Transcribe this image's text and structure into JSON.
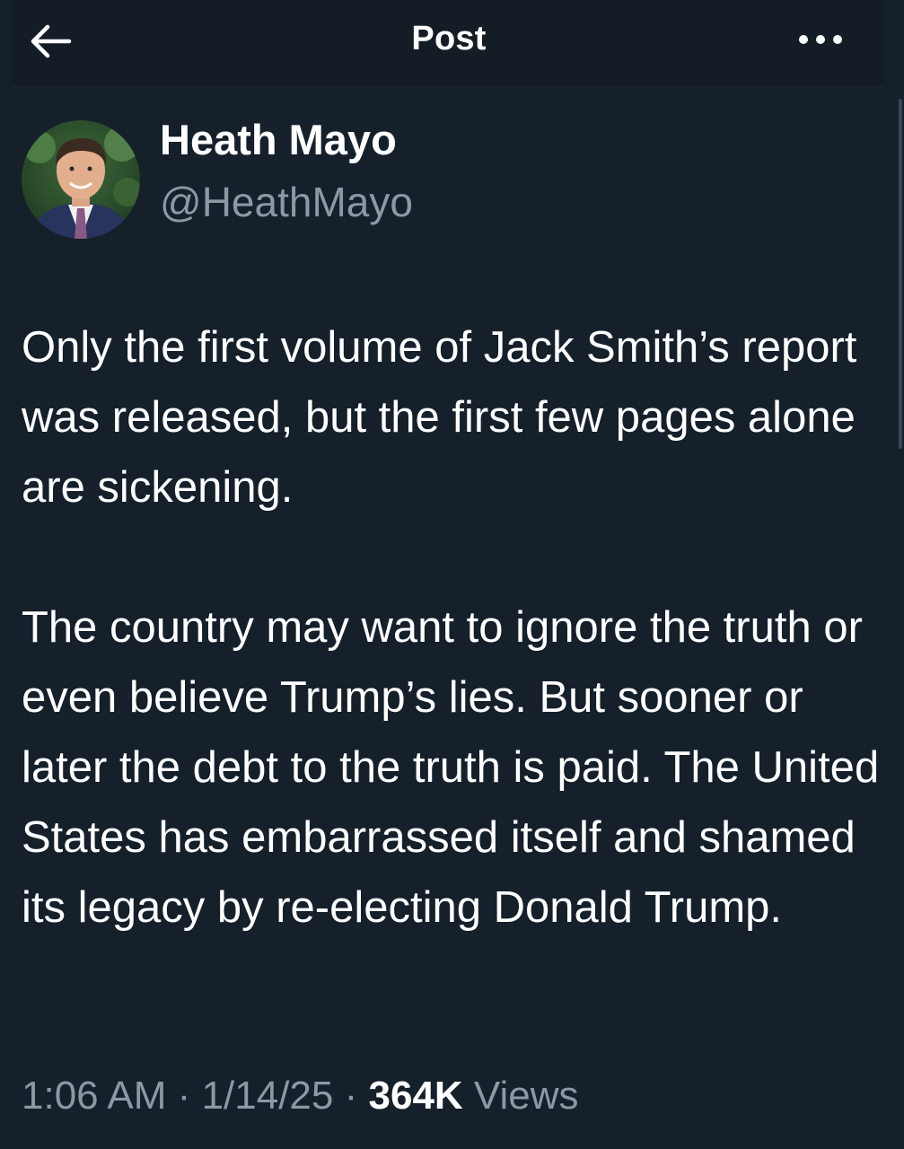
{
  "header": {
    "title": "Post",
    "back_icon": "arrow-left-icon",
    "more_icon": "more-horizontal-icon"
  },
  "author": {
    "display_name": "Heath Mayo",
    "handle": "@HeathMayo"
  },
  "post": {
    "paragraphs": [
      "Only the first volume of Jack Smith’s report was released, but the first few pages alone are sickening.",
      "The country may want to ignore the truth or even believe Trump’s lies. But sooner or later the debt to the truth is paid. The United States has embarrassed itself and shamed its legacy by re-electing Donald Trump."
    ]
  },
  "meta": {
    "time": "1:06 AM",
    "separator": "·",
    "date": "1/14/25",
    "views_count": "364K",
    "views_label": "Views"
  },
  "colors": {
    "background": "#15202b",
    "text_primary": "#ffffff",
    "text_secondary": "#8b98a5"
  }
}
